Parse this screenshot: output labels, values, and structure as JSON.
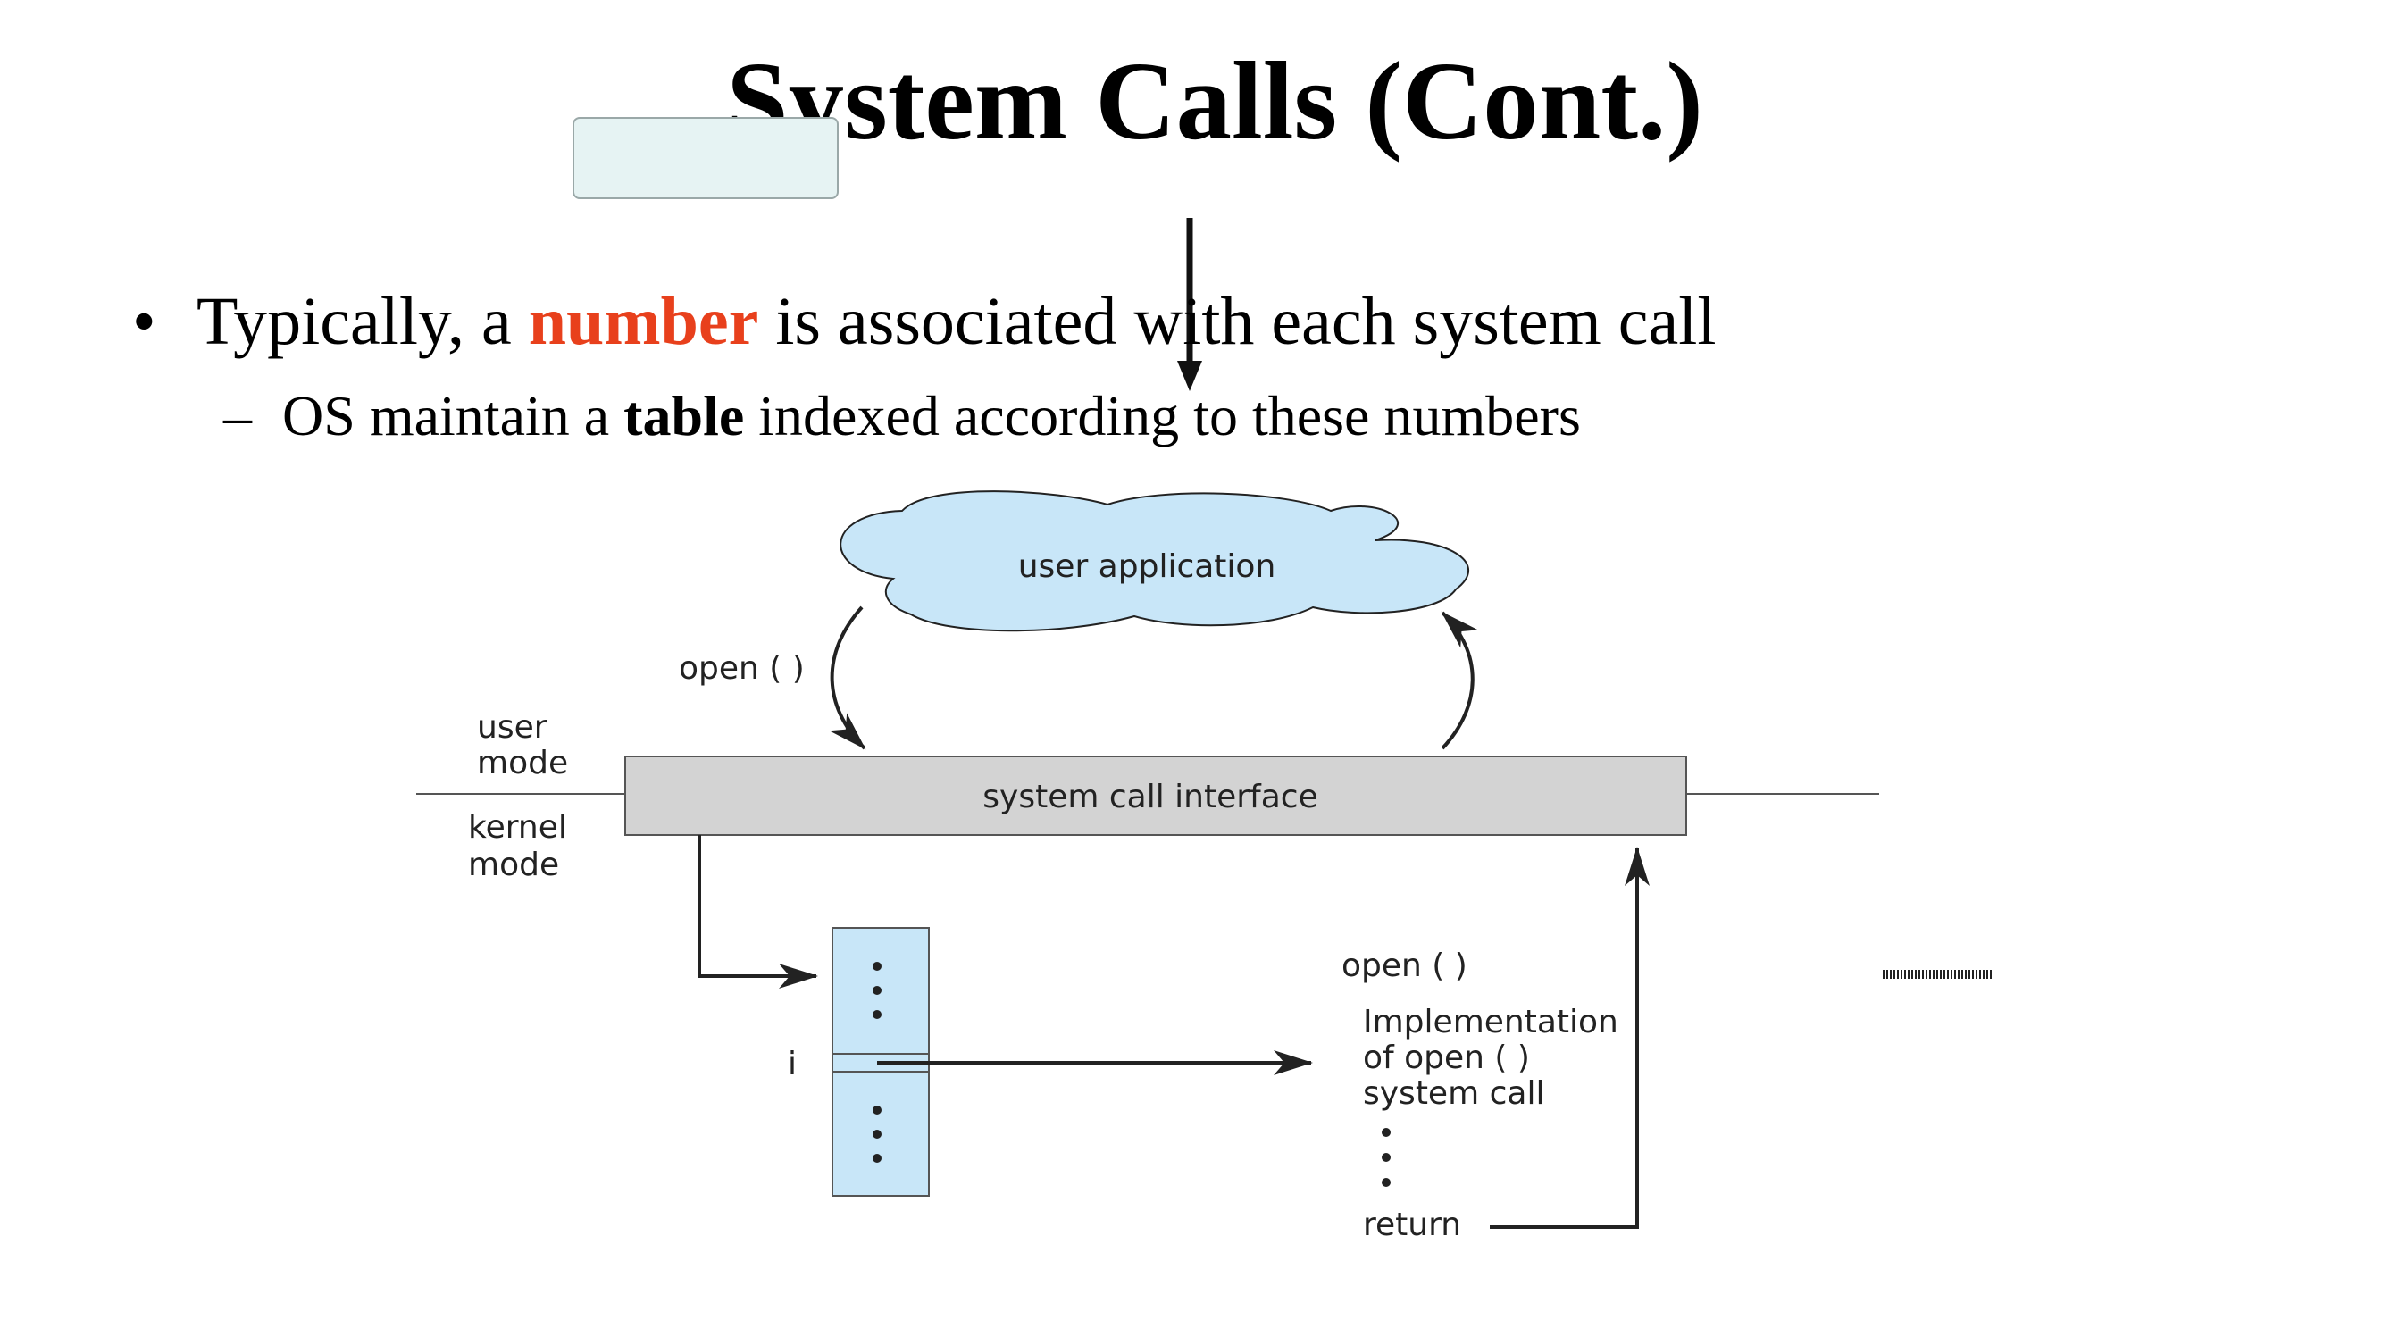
{
  "slide": {
    "title": "System Calls (Cont.)"
  },
  "bullets": {
    "level1": {
      "marker": "•",
      "pre": "Typically, a ",
      "emphasis": "number",
      "post": " is associated with each system call",
      "emphasis_color": "#e8401c"
    },
    "level2": {
      "marker": "–",
      "pre": "OS maintain a ",
      "emphasis": "table",
      "post": " indexed according to these numbers"
    }
  },
  "diagram": {
    "cloud_label": "user application",
    "call_label": "open ( )",
    "user_mode_line1": "user",
    "user_mode_line2": "mode",
    "kernel_mode_line1": "kernel",
    "kernel_mode_line2": "mode",
    "interface_label": "system call interface",
    "index_label": "i",
    "impl_title": "open ( )",
    "impl_line1": "Implementation",
    "impl_line2": "of open ( )",
    "impl_line3": "system call",
    "return_label": "return",
    "colors": {
      "cloud_fill": "#c8e6f8",
      "table_fill": "#c8e6f8",
      "interface_fill": "#d3d3d3",
      "stroke": "#222222"
    }
  }
}
